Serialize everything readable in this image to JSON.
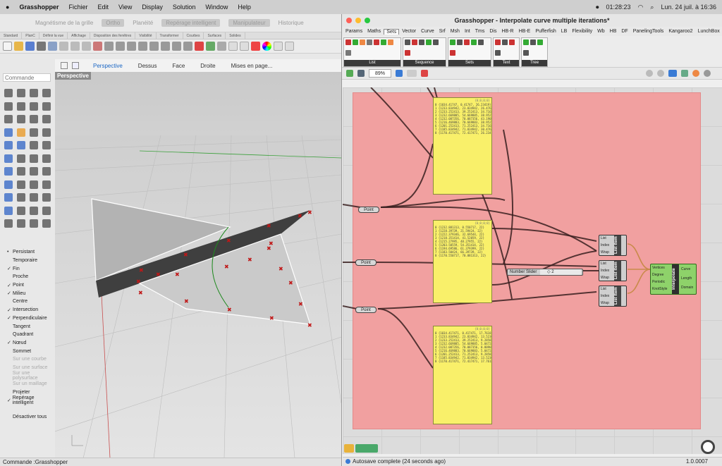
{
  "menubar": {
    "apple": "",
    "app": "Grasshopper",
    "items": [
      "Fichier",
      "Edit",
      "View",
      "Display",
      "Solution",
      "Window",
      "Help"
    ],
    "timer": "01:28:23",
    "clock": "Lun. 24 juil. à 16:36"
  },
  "rhino": {
    "status_items": [
      "Magnétisme de la grille",
      "Ortho",
      "Planéité",
      "Repérage intelligent",
      "Manipulateur",
      "Historique"
    ],
    "tabs": [
      "Standard",
      "PlanC",
      "Définir la vue",
      "Affichage",
      "Disposition des fenêtres",
      "Visibilité",
      "Transformer",
      "Courbes",
      "Surfaces",
      "Solides"
    ],
    "command_placeholder": "Commande",
    "view_tabs": [
      "Perspective",
      "Dessus",
      "Face",
      "Droite",
      "Mises en page..."
    ],
    "viewport_label": "Perspective",
    "osnaps": [
      {
        "label": "Persistant",
        "mark": "•"
      },
      {
        "label": "Temporaire",
        "mark": ""
      },
      {
        "label": "Fin",
        "mark": "✓"
      },
      {
        "label": "Proche",
        "mark": ""
      },
      {
        "label": "Point",
        "mark": "✓"
      },
      {
        "label": "Milieu",
        "mark": "✓"
      },
      {
        "label": "Centre",
        "mark": ""
      },
      {
        "label": "Intersection",
        "mark": "✓"
      },
      {
        "label": "Perpendiculaire",
        "mark": "✓"
      },
      {
        "label": "Tangent",
        "mark": ""
      },
      {
        "label": "Quadrant",
        "mark": ""
      },
      {
        "label": "Nœud",
        "mark": "✓"
      },
      {
        "label": "Sommet",
        "mark": ""
      },
      {
        "label": "Sur une courbe",
        "mark": "",
        "disabled": true
      },
      {
        "label": "Sur une surface",
        "mark": "",
        "disabled": true
      },
      {
        "label": "Sur une polysurface",
        "mark": "",
        "disabled": true
      },
      {
        "label": "Sur un maillage",
        "mark": "",
        "disabled": true
      },
      {
        "label": "Projeter",
        "mark": ""
      },
      {
        "label": "Repérage intelligent",
        "mark": "✓"
      },
      {
        "label": "",
        "mark": ""
      },
      {
        "label": "Désactiver tous",
        "mark": ""
      }
    ],
    "command_status": "Commande :Grasshopper"
  },
  "gh": {
    "title": "Grasshopper - Interpolate curve multiple iterations*",
    "menu": [
      "Params",
      "Maths",
      "Sets",
      "Vector",
      "Curve",
      "Srf",
      "Msh",
      "Int",
      "Tms",
      "Dis",
      "HB-R",
      "HB-E",
      "Pufferfish",
      "LB",
      "Flexibility",
      "Wb",
      "HB",
      "DF",
      "PanelingTools",
      "Kangaroo2",
      "LunchBox"
    ],
    "selected_menu": "Sets",
    "ribbon_groups": [
      "List",
      "Sequence",
      "Sets",
      "Text",
      "Tree"
    ],
    "zoom": "89%",
    "point_label": "Point",
    "slider_label": "Number Slider",
    "slider_value": "◇ 2",
    "list_item_inputs": [
      "List",
      "Index",
      "Wrap"
    ],
    "list_item_title": "List Item",
    "interpolate_inputs": [
      "Vertices",
      "Degree",
      "Periodic",
      "KnotStyle"
    ],
    "interpolate_title": "Interpolate",
    "interpolate_outputs": [
      "Curve",
      "Length",
      "Domain"
    ],
    "panel_header": "{0;0;0;0}",
    "panel1": [
      "{1034.41747, 0.41747, 26.23419}",
      "{1233.834942, 23.034942, 26.47638}",
      "{1233.252413, 39.252413, 34.71654}",
      "{1232.669885, 54.669885, 38.952758}",
      "{1232.087356, 70.087356, 43.190569}",
      "{1216.469883, 70.669883, 38.952758}",
      "{1201.252413, 71.252413, 34.71654}",
      "{1185.834942, 71.834942, 30.47638}",
      "{1170.417471, 72.417471, 26.23419}"
    ],
    "panel2": [
      "{1232.881313, 0.550717, 22}",
      "{1228.39739, 21.59424, 22}",
      "{1222.379346, 32.69544, 22}",
      "{1218.351414, 41.52059, 22}",
      "{1215.27995, 48.27955, 22}",
      "{1203.50559, 54.351414, 22}",
      "{1194.69586, 61.379399, 22}",
      "{1183.50424, 66.39739, 22}",
      "{1170.550717, 70.881313, 22}"
    ],
    "panel3": [
      "{1034.417471, 0.417471, 17.76181}",
      "{1233.834942, 23.834942, 13.52362}",
      "{1233.252413, 39.252413, 9.285831}",
      "{1232.669885, 54.669885, 5.047241}",
      "{1232.087356, 70.087356, 0.809031}",
      "{1216.469883, 70.669883, 5.047241}",
      "{1201.252413, 71.252413, 9.285831}",
      "{1185.834942, 71.834942, 13.52362}",
      "{1170.417471, 72.417471, 17.76181}"
    ],
    "status": "Autosave complete (24 seconds ago)",
    "version": "1.0.0007"
  }
}
